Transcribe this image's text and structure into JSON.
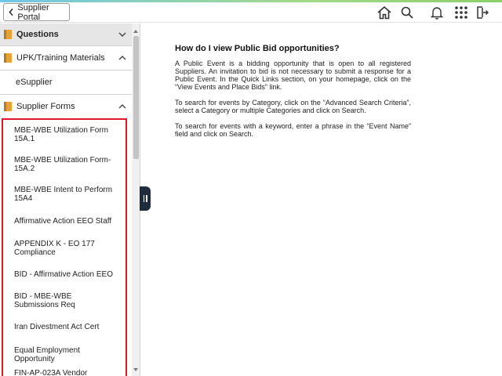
{
  "header": {
    "back_label": "Supplier Portal"
  },
  "sidebar": {
    "sections": {
      "questions": "Questions",
      "upk": "UPK/Training Materials",
      "esupplier": "eSupplier",
      "supplier_forms": "Supplier Forms"
    },
    "forms": [
      "MBE-WBE Utilization Form 15A.1",
      "MBE-WBE Utilization Form-15A.2",
      "MBE-WBE Intent to Perform 15A4",
      "Affirmative Action EEO Staff",
      "APPENDIX K - EO 177 Compliance",
      "BID - Affirmative Action EEO",
      "BID - MBE-WBE Submissions Req",
      "Iran Divestment Act Cert",
      "Equal Employment Opportunity",
      "FIN-AP-023A Vendor"
    ]
  },
  "content": {
    "title": "How do I view Public Bid opportunities?",
    "paragraphs": [
      "A Public Event is a bidding opportunity that is open to all registered Suppliers. An invitation to bid is not necessary to submit a response for a Public Event. In the Quick Links section, on your homepage, click on the “View Events and Place Bids” link.",
      "To search for events by Category, click on the “Advanced Search Criteria”, select a Category or multiple Categories and click on Search.",
      "To search for events with a keyword, enter a phrase in the “Event Name” field and click on Search."
    ]
  },
  "colors": {
    "highlight_border": "#e0182d",
    "folder_icon": "#e6a233",
    "handle": "#1f2c3b"
  }
}
